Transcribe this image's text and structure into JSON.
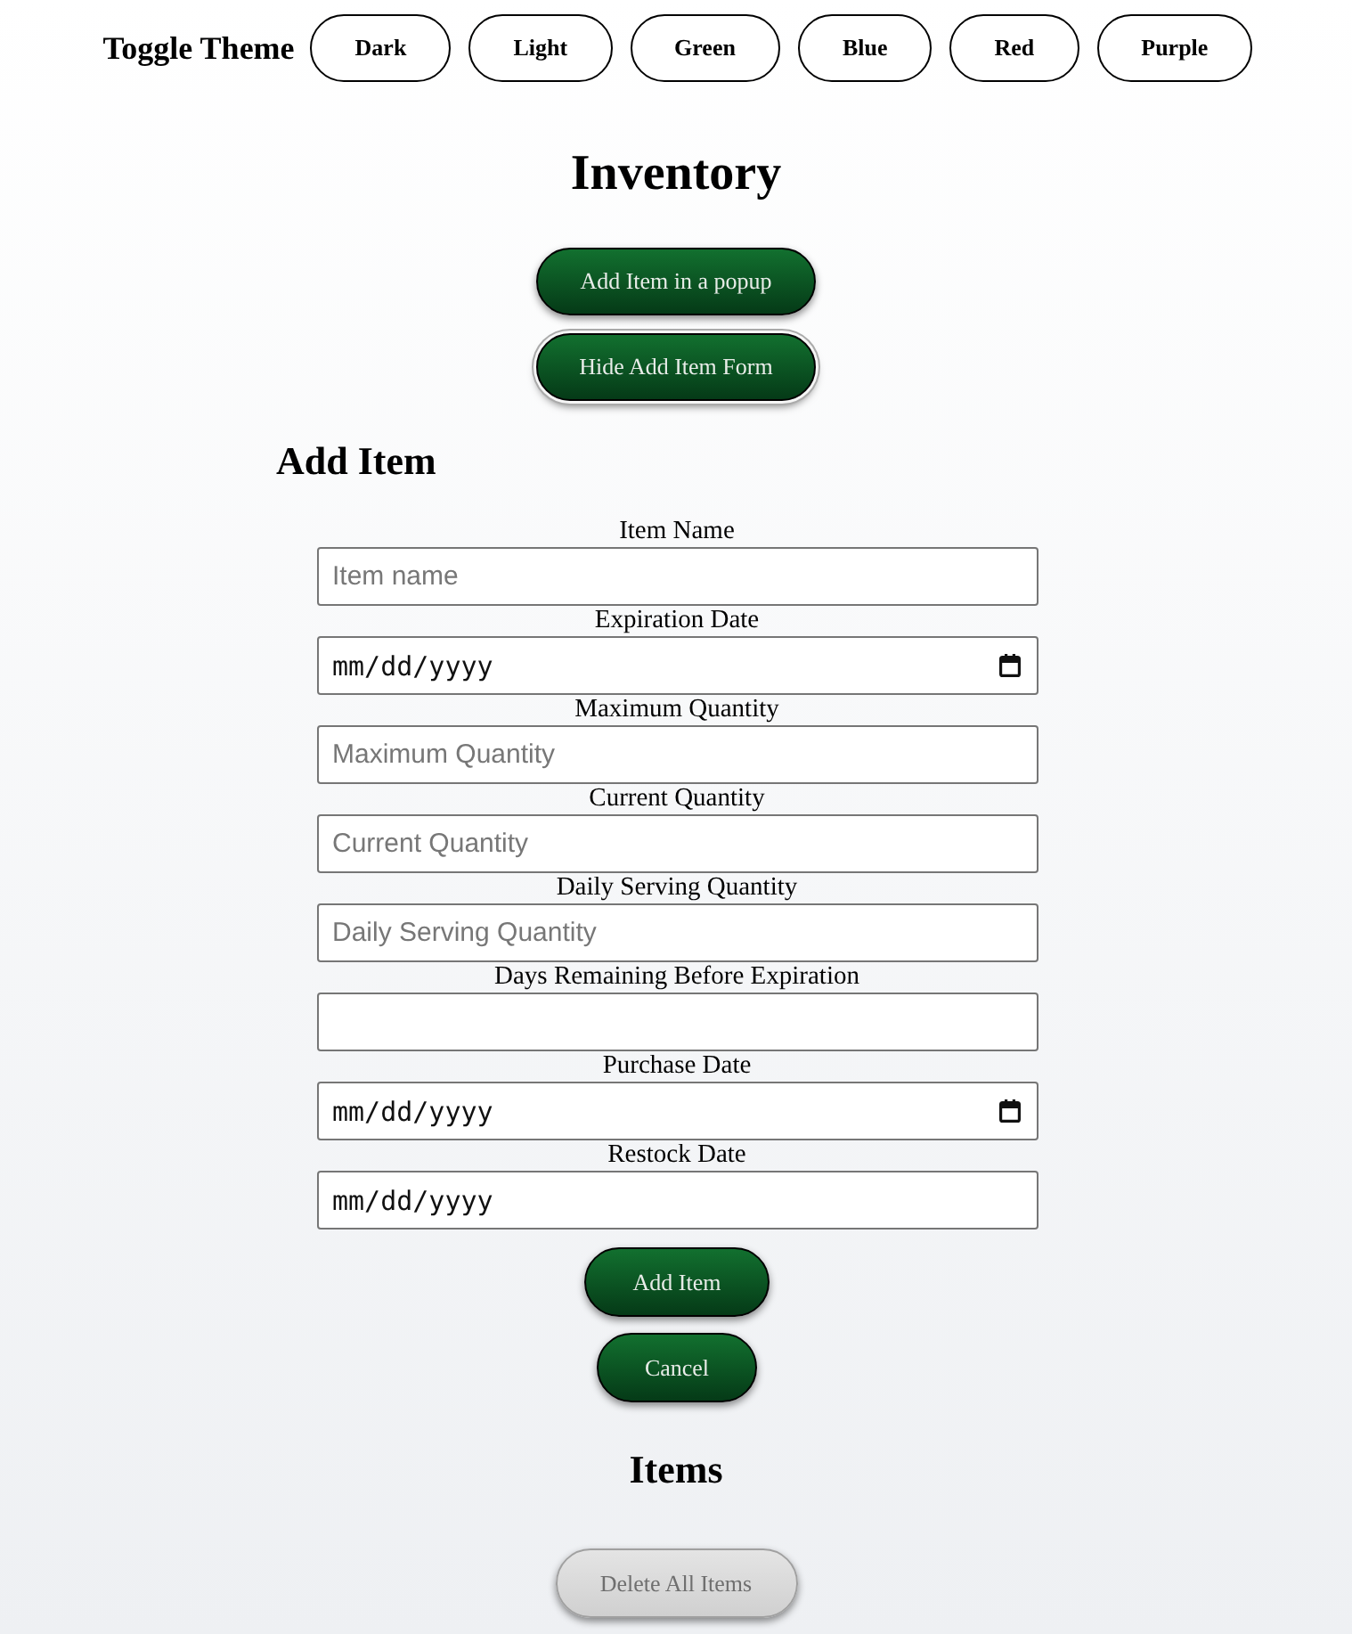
{
  "theme_bar": {
    "label": "Toggle Theme",
    "options": [
      "Dark",
      "Light",
      "Green",
      "Blue",
      "Red",
      "Purple"
    ]
  },
  "title": "Inventory",
  "actions": [
    {
      "label": "Add Item in a popup",
      "focused": false
    },
    {
      "label": "Hide Add Item Form",
      "focused": true
    }
  ],
  "form": {
    "heading": "Add Item",
    "fields": [
      {
        "label": "Item Name",
        "kind": "text",
        "placeholder": "Item name",
        "picker_icon": false
      },
      {
        "label": "Expiration Date",
        "kind": "date",
        "placeholder": "mm/dd/yyyy",
        "picker_icon": true
      },
      {
        "label": "Maximum Quantity",
        "kind": "text",
        "placeholder": "Maximum Quantity",
        "picker_icon": false
      },
      {
        "label": "Current Quantity",
        "kind": "text",
        "placeholder": "Current Quantity",
        "picker_icon": false
      },
      {
        "label": "Daily Serving Quantity",
        "kind": "text",
        "placeholder": "Daily Serving Quantity",
        "picker_icon": false
      },
      {
        "label": "Days Remaining Before Expiration",
        "kind": "text",
        "picker_icon": false
      },
      {
        "label": "Purchase Date",
        "kind": "date",
        "placeholder": "mm/dd/yyyy",
        "picker_icon": true
      },
      {
        "label": "Restock Date",
        "kind": "date",
        "placeholder": "mm/dd/yyyy",
        "picker_icon": false
      }
    ],
    "buttons": [
      "Add Item",
      "Cancel"
    ]
  },
  "items": {
    "heading": "Items",
    "delete_button": {
      "label": "Delete All Items",
      "disabled": true
    }
  }
}
